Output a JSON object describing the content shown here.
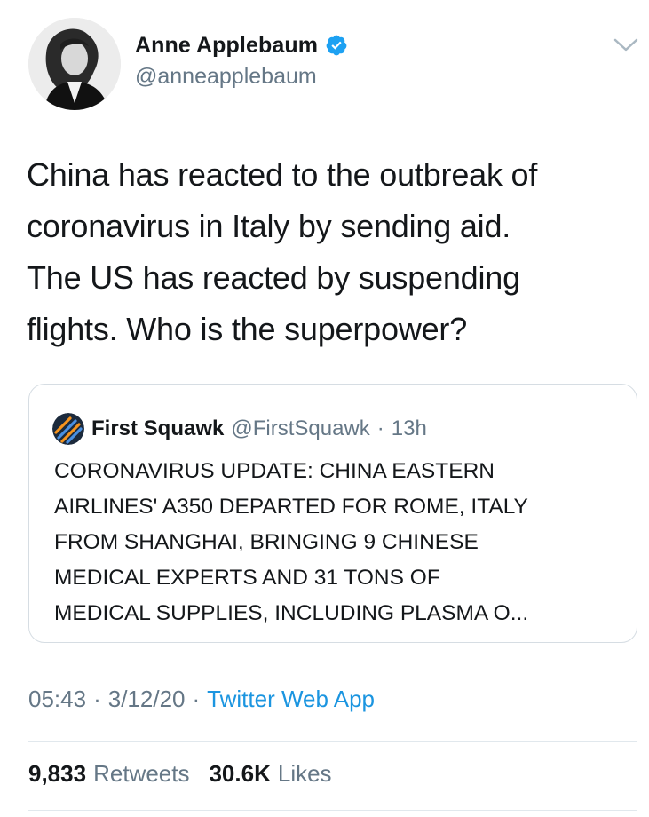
{
  "author": {
    "name": "Anne Applebaum",
    "handle": "@anneapplebaum",
    "verified": true
  },
  "tweet": {
    "lines": [
      "China has reacted to the outbreak of",
      "coronavirus in Italy by sending aid.",
      "The US has reacted by suspending",
      "flights. Who is the superpower?"
    ]
  },
  "quoted_tweet": {
    "name": "First Squawk",
    "handle": "@FirstSquawk",
    "separator": "·",
    "age": "13h",
    "lines": [
      "CORONAVIRUS UPDATE: CHINA EASTERN",
      "AIRLINES' A350 DEPARTED FOR ROME, ITALY",
      "FROM SHANGHAI, BRINGING 9 CHINESE",
      "MEDICAL EXPERTS AND 31 TONS OF",
      "MEDICAL SUPPLIES, INCLUDING PLASMA O..."
    ]
  },
  "meta": {
    "time": "05:43",
    "sep1": "·",
    "date": "3/12/20",
    "sep2": "·",
    "source": "Twitter Web App"
  },
  "stats": {
    "retweets_count": "9,833",
    "retweets_label": "Retweets",
    "likes_count": "30.6K",
    "likes_label": "Likes"
  },
  "colors": {
    "text": "#14171a",
    "secondary": "#657786",
    "link": "#1b95e0",
    "verified": "#1da1f2",
    "border": "#d6dde3"
  },
  "icons": {
    "verified": "verified-badge-icon",
    "menu": "chevron-down-icon"
  }
}
